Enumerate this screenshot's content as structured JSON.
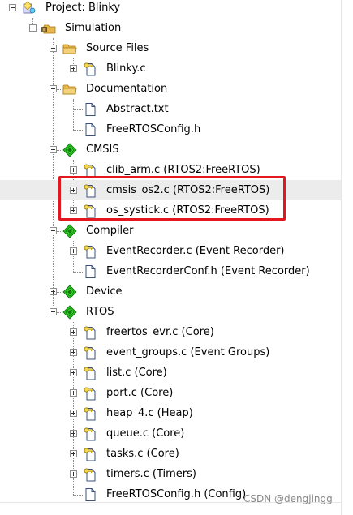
{
  "project": {
    "label": "Project: Blinky"
  },
  "groups": {
    "simulation": {
      "label": "Simulation"
    },
    "source_files": {
      "label": "Source Files",
      "files": [
        "Blinky.c"
      ]
    },
    "documentation": {
      "label": "Documentation",
      "files": [
        "Abstract.txt",
        "FreeRTOSConfig.h"
      ]
    },
    "cmsis": {
      "label": "CMSIS",
      "files": [
        "clib_arm.c (RTOS2:FreeRTOS)",
        "cmsis_os2.c (RTOS2:FreeRTOS)",
        "os_systick.c (RTOS2:FreeRTOS)"
      ]
    },
    "compiler": {
      "label": "Compiler",
      "files": [
        "EventRecorder.c (Event Recorder)",
        "EventRecorderConf.h (Event Recorder)"
      ]
    },
    "device": {
      "label": "Device"
    },
    "rtos": {
      "label": "RTOS",
      "files": [
        "freertos_evr.c (Core)",
        "event_groups.c (Event Groups)",
        "list.c (Core)",
        "port.c (Core)",
        "heap_4.c (Heap)",
        "queue.c (Core)",
        "tasks.c (Core)",
        "timers.c (Timers)",
        "FreeRTOSConfig.h (Config)"
      ]
    }
  },
  "watermark": "CSDN @dengjingg",
  "colors": {
    "highlight_border": "#e4161e",
    "selected_row": "#ececec",
    "component_green": "#27c21f",
    "folder_yellow": "#e8b84a"
  }
}
